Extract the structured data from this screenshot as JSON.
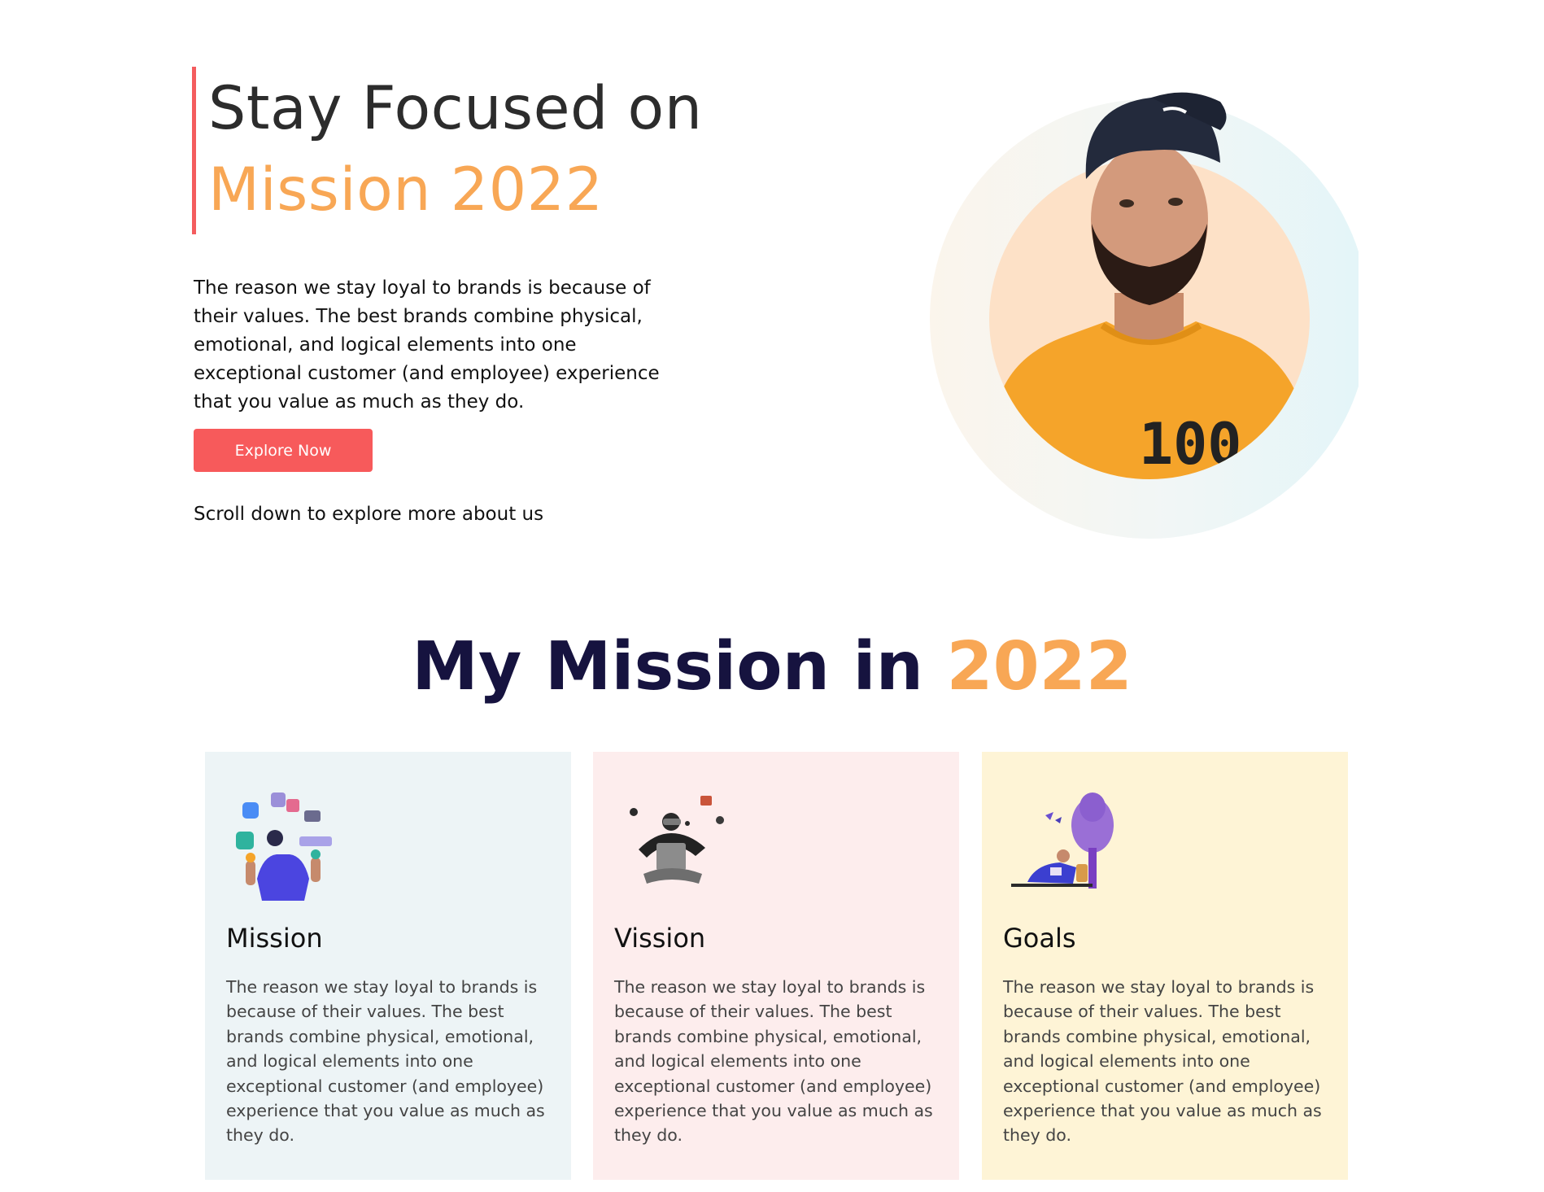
{
  "hero": {
    "title_line1": "Stay Focused on",
    "title_line2": "Mission 2022",
    "description": "The reason we stay loyal to brands is because of their values. The best brands combine physical, emotional, and logical elements into one exceptional customer (and employee) experience that you value as much as they do.",
    "cta_label": "Explore Now",
    "scroll_hint": "Scroll down to explore more about us"
  },
  "section": {
    "title_main": "My Mission in ",
    "title_accent": "2022"
  },
  "cards": [
    {
      "title": "Mission",
      "text": "The reason we stay loyal to brands is because of their values. The best brands combine physical, emotional, and logical elements into one exceptional customer (and employee) experience that you value as much as they do.",
      "background": "#edf4f6",
      "icon": "juggling-apps-illustration-icon"
    },
    {
      "title": "Vission",
      "text": "The reason we stay loyal to brands is because of their values. The best brands combine physical, emotional, and logical elements into one exceptional customer (and employee) experience that you value as much as they do.",
      "background": "#fdeded",
      "icon": "vr-meditation-illustration-icon"
    },
    {
      "title": "Goals",
      "text": "The reason we stay loyal to brands is because of their values. The best brands combine physical, emotional, and logical elements into one exceptional customer (and employee) experience that you value as much as they do.",
      "background": "#fef4d6",
      "icon": "reading-under-tree-illustration-icon"
    }
  ],
  "colors": {
    "accent_orange": "#f8a755",
    "accent_red": "#f75a5b",
    "title_navy": "#16133f",
    "text_dark": "#2c2c2c"
  }
}
